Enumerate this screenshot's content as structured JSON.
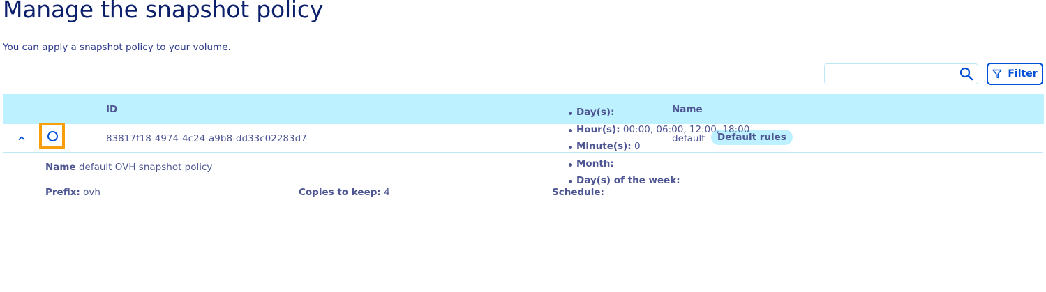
{
  "header": {
    "title": "Manage the snapshot policy",
    "subtitle": "You can apply a snapshot policy to your volume."
  },
  "toolbar": {
    "search_value": "",
    "filter_label": "Filter"
  },
  "table": {
    "columns": [
      "ID",
      "Name"
    ],
    "rows": [
      {
        "id": "83817f18-4974-4c24-a9b8-dd33c02283d7",
        "name": "default",
        "badge": "Default rules",
        "selected": false,
        "expanded": true
      }
    ]
  },
  "details": {
    "name_label": "Name",
    "name_value": "default OVH snapshot policy",
    "prefix_label": "Prefix:",
    "prefix_value": "ovh",
    "copies_label": "Copies to keep:",
    "copies_value": "4",
    "schedule_label": "Schedule:",
    "schedule": [
      {
        "label": "Day(s):",
        "value": ""
      },
      {
        "label": "Hour(s):",
        "value": "00:00, 06:00, 12:00, 18:00"
      },
      {
        "label": "Minute(s):",
        "value": "0"
      },
      {
        "label": "Month:",
        "value": ""
      },
      {
        "label": "Day(s) of the week:",
        "value": ""
      }
    ]
  },
  "colors": {
    "accent": "#0050d7",
    "header_bg": "#bef1ff",
    "highlight": "#f99e0b",
    "text": "#4d5693"
  }
}
